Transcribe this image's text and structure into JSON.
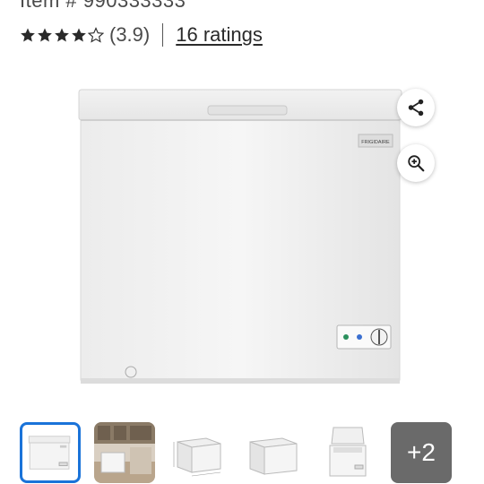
{
  "item_number": "Item # 990333333",
  "rating": {
    "stars_value": 3.9,
    "display": "(3.9)",
    "count_link": "16 ratings"
  },
  "product_image": {
    "brand_plate": "FRIGIDAIRE"
  },
  "actions": {
    "share_icon": "share-icon",
    "zoom_icon": "zoom-in-icon"
  },
  "thumbnails": {
    "selected_index": 0,
    "more_label": "+2"
  },
  "colors": {
    "selected_border": "#1a73d9",
    "more_tile": "#6a6a6a"
  }
}
